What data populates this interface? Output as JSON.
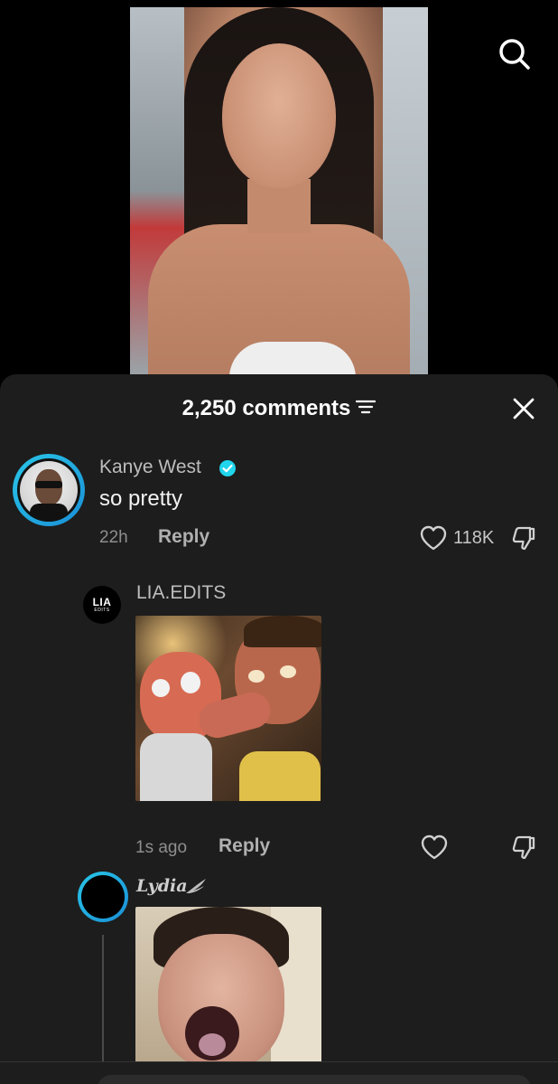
{
  "video": {
    "search_icon": "search-icon"
  },
  "sheet": {
    "comments_count": "2,250 comments",
    "sort_icon": "sort-icon",
    "close_icon": "close-icon"
  },
  "comments": [
    {
      "username": "Kanye West",
      "verified": true,
      "text": "so pretty",
      "time": "22h",
      "reply_label": "Reply",
      "likes": "118K",
      "ring_color": "#29c6e8"
    },
    {
      "username": "LIA.EDITS",
      "avatar_text": "LIA",
      "avatar_subtext": "EDITS",
      "time": "1s ago",
      "reply_label": "Reply",
      "has_gif": true
    },
    {
      "username": "Lydia",
      "has_gif": true,
      "ring_color": "#29c6e8"
    }
  ],
  "colors": {
    "sheet_bg": "#1d1d1d",
    "accent_ring": "#29c6e8",
    "verified_badge": "#20d5ec"
  }
}
